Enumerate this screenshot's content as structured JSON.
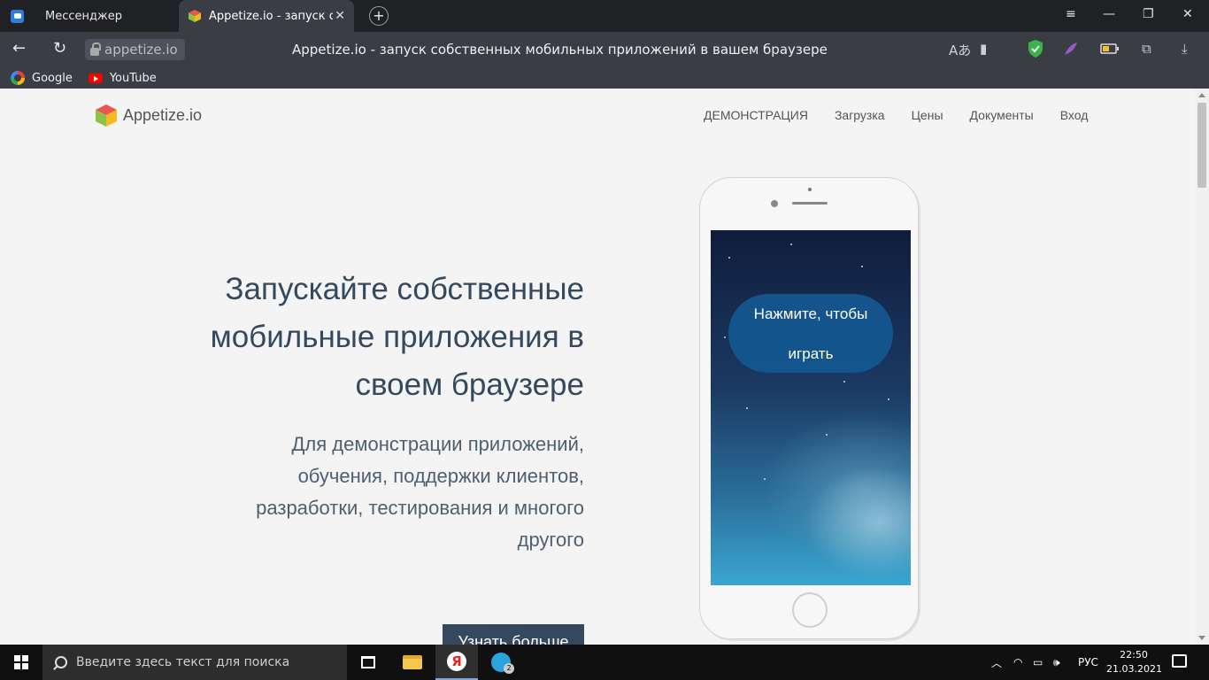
{
  "browser": {
    "tabs": [
      {
        "title": "Мессенджер",
        "active": false
      },
      {
        "title": "Appetize.io - запуск соб",
        "active": true
      }
    ],
    "new_tab_symbol": "+",
    "tab_close_symbol": "✕",
    "window_controls": {
      "menu": "≡",
      "minimize": "—",
      "restore": "❐",
      "close": "✕"
    },
    "address": {
      "url": "appetize.io",
      "page_title": "Appetize.io - запуск собственных мобильных приложений в вашем браузере"
    },
    "bookmarks": [
      {
        "label": "Google",
        "icon": "google-icon"
      },
      {
        "label": "YouTube",
        "icon": "youtube-icon"
      }
    ]
  },
  "site": {
    "logo_text": "Appetize.io",
    "nav": [
      "ДЕМОНСТРАЦИЯ",
      "Загрузка",
      "Цены",
      "Документы",
      "Вход"
    ],
    "hero": {
      "title_lines": [
        "Запускайте собственные",
        "мобильные приложения в",
        "своем браузере"
      ],
      "subtitle_lines": [
        "Для демонстрации приложений,",
        "обучения, поддержки клиентов,",
        "разработки, тестирования и многого",
        "другого"
      ],
      "cta": "Узнать больше"
    },
    "phone": {
      "play_lines": [
        "Нажмите, чтобы",
        "играть"
      ]
    }
  },
  "taskbar": {
    "search_placeholder": "Введите здесь текст для поиска",
    "yandex_letter": "Я",
    "telegram_badge": "2",
    "language": "РУС",
    "time": "22:50",
    "date": "21.03.2021"
  },
  "colors": {
    "heading": "#34495e",
    "cta_bg": "#34495e",
    "browser_dark": "#202124",
    "toolbar": "#3b3d44"
  }
}
